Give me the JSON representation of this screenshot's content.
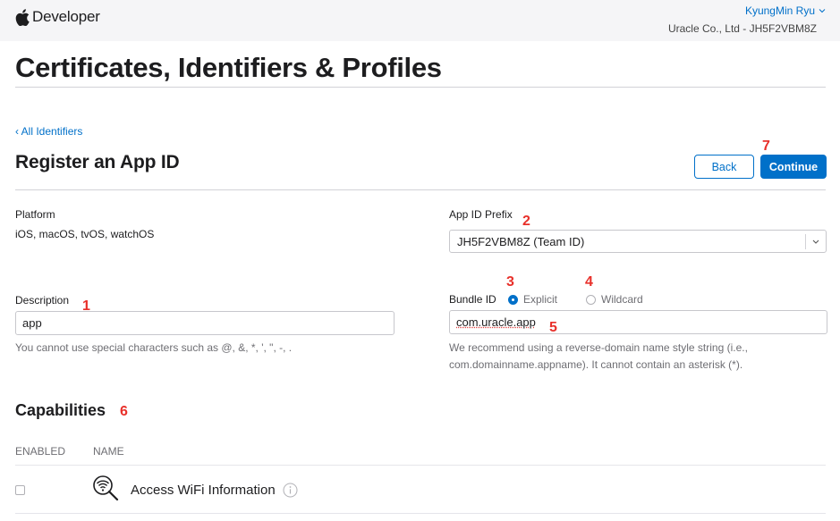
{
  "header": {
    "brand": "Developer",
    "user_name": "KyungMin Ryu",
    "org": "Uracle Co., Ltd - JH5F2VBM8Z"
  },
  "page": {
    "title": "Certificates, Identifiers & Profiles",
    "back_link": "All Identifiers",
    "section_title": "Register an App ID",
    "back_button": "Back",
    "continue_button": "Continue"
  },
  "form": {
    "platform_label": "Platform",
    "platform_value": "iOS, macOS, tvOS, watchOS",
    "prefix_label": "App ID Prefix",
    "prefix_value": "JH5F2VBM8Z (Team ID)",
    "description_label": "Description",
    "description_value": "app",
    "description_help": "You cannot use special characters such as @, &, *, ', \", -, .",
    "bundle_label": "Bundle ID",
    "bundle_options": [
      "Explicit",
      "Wildcard"
    ],
    "bundle_selected": "Explicit",
    "bundle_value": "com.uracle.app",
    "bundle_help_1": "We recommend using a reverse-domain name style string (i.e.,",
    "bundle_help_2": "com.domainname.appname). It cannot contain an asterisk (*)."
  },
  "capabilities": {
    "title": "Capabilities",
    "col_enabled": "ENABLED",
    "col_name": "NAME",
    "items": [
      {
        "name": "Access WiFi Information",
        "enabled": false,
        "icon": "wifi-magnifier-icon"
      }
    ]
  },
  "annotations": [
    "1",
    "2",
    "3",
    "4",
    "5",
    "6",
    "7"
  ],
  "colors": {
    "accent": "#0070c9",
    "annotation": "#e8302a",
    "header_bg": "#f5f5f7"
  }
}
